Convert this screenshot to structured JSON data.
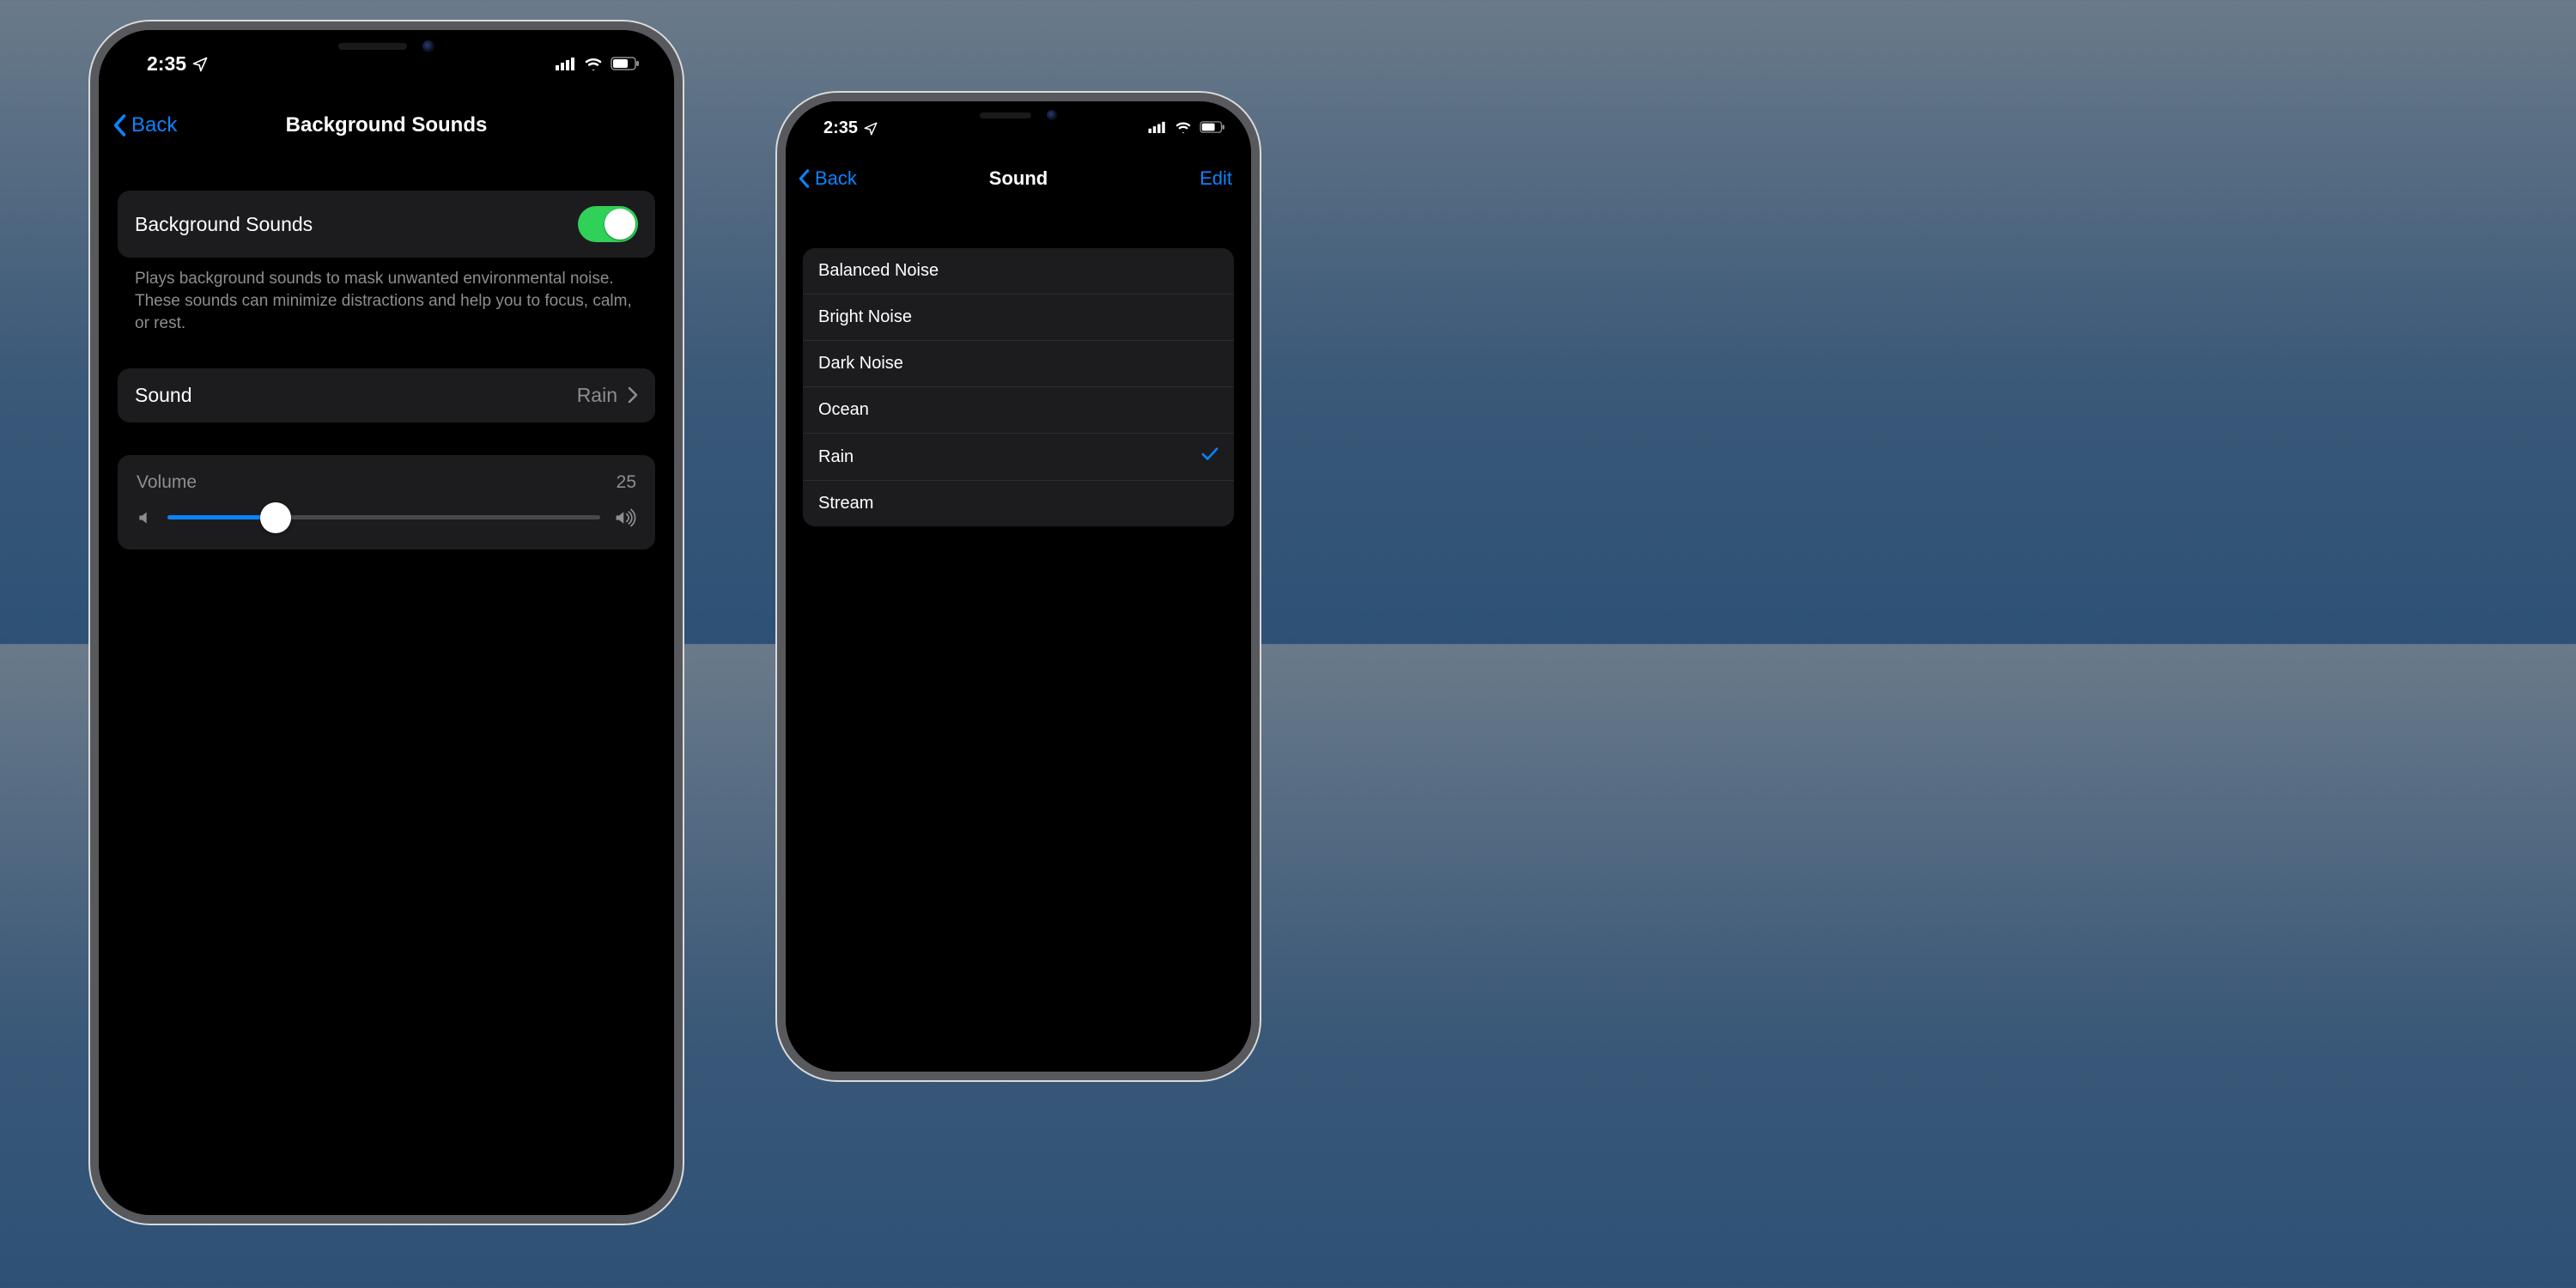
{
  "status": {
    "time": "2:35"
  },
  "phone1": {
    "back_label": "Back",
    "title": "Background Sounds",
    "toggle": {
      "label": "Background Sounds",
      "on": true
    },
    "footer": "Plays background sounds to mask unwanted environmental noise. These sounds can minimize distractions and help you to focus, calm, or rest.",
    "sound_row": {
      "label": "Sound",
      "value": "Rain"
    },
    "volume": {
      "label": "Volume",
      "value": "25",
      "percent": 25
    }
  },
  "phone2": {
    "back_label": "Back",
    "title": "Sound",
    "edit_label": "Edit",
    "options": [
      {
        "label": "Balanced Noise",
        "selected": false
      },
      {
        "label": "Bright Noise",
        "selected": false
      },
      {
        "label": "Dark Noise",
        "selected": false
      },
      {
        "label": "Ocean",
        "selected": false
      },
      {
        "label": "Rain",
        "selected": true
      },
      {
        "label": "Stream",
        "selected": false
      }
    ]
  }
}
